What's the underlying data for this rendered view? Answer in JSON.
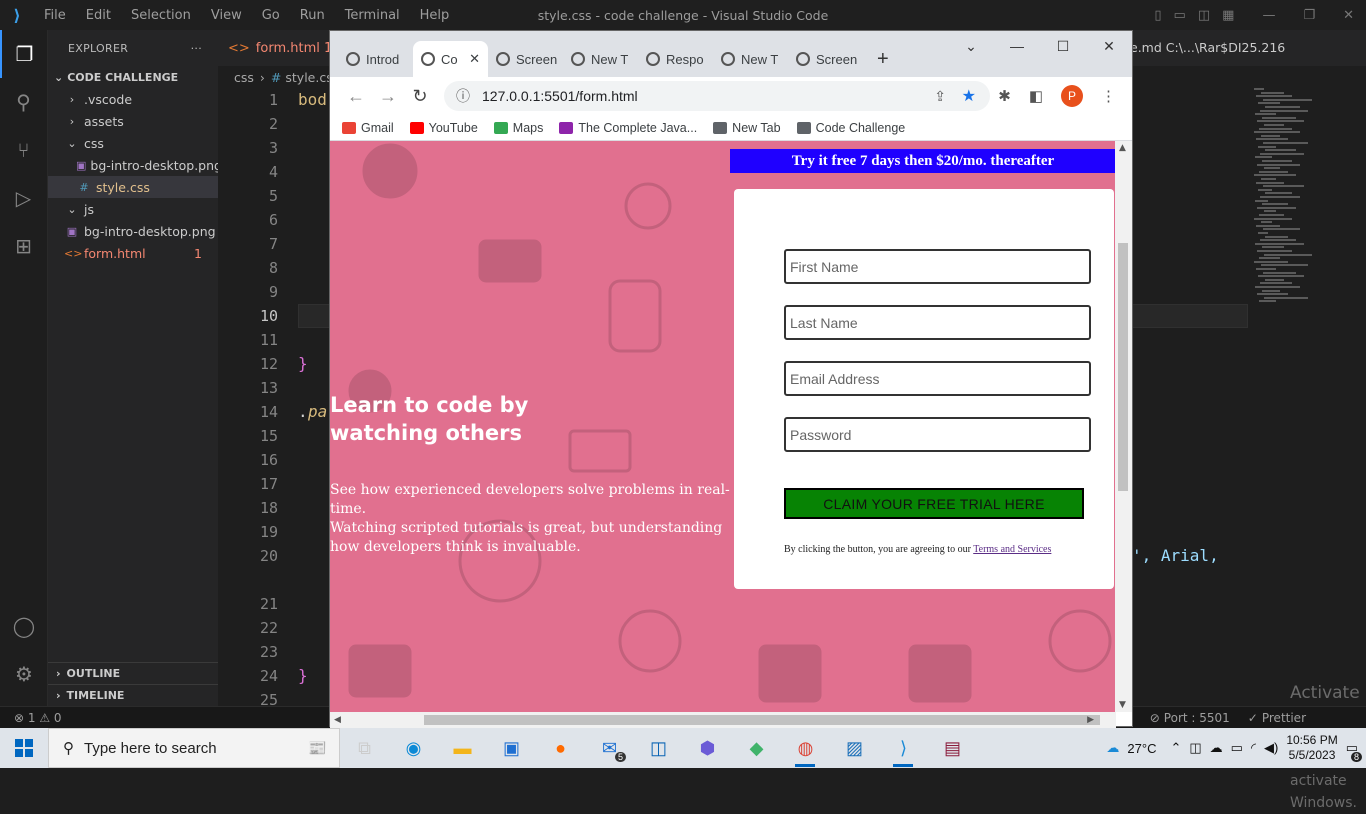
{
  "vscode": {
    "menu": [
      "File",
      "Edit",
      "Selection",
      "View",
      "Go",
      "Run",
      "Terminal",
      "Help"
    ],
    "window_title": "style.css - code challenge - Visual Studio Code",
    "explorer_label": "EXPLORER",
    "project": "CODE CHALLENGE",
    "tree": [
      {
        "label": ".vscode",
        "type": "folder-closed",
        "indent": 1
      },
      {
        "label": "assets",
        "type": "folder-closed",
        "indent": 1
      },
      {
        "label": "css",
        "type": "folder-open",
        "indent": 1
      },
      {
        "label": "bg-intro-desktop.png",
        "type": "image",
        "indent": 2
      },
      {
        "label": "style.css",
        "type": "css",
        "indent": 2,
        "selected": true
      },
      {
        "label": "js",
        "type": "folder-open",
        "indent": 1
      },
      {
        "label": "bg-intro-desktop.png",
        "type": "image",
        "indent": 1
      },
      {
        "label": "form.html",
        "type": "html",
        "indent": 1,
        "badge": "1",
        "error": true
      }
    ],
    "outline_label": "OUTLINE",
    "timeline_label": "TIMELINE",
    "editor_tab": "form.html 1",
    "breadcrumb": [
      "css",
      "style.cs"
    ],
    "line_numbers": [
      "1",
      "2",
      "3",
      "4",
      "5",
      "6",
      "7",
      "8",
      "9",
      "10",
      "11",
      "12",
      "13",
      "14",
      "15",
      "16",
      "17",
      "18",
      "19",
      "20",
      "",
      "21",
      "22",
      "23",
      "24",
      "25"
    ],
    "current_line": "10",
    "code_fragments": {
      "l1": "bod",
      "l12": "}",
      "l14a": ".",
      "l14b": "pa",
      "l20": "', Arial,",
      "l24": "}"
    },
    "right_path": "e.md  C:\\...\\Rar$DI25.216",
    "activate_title": "Activate Windows",
    "activate_sub": "Go to Settings to activate Windows.",
    "status": {
      "errors": "⊗ 1 ⚠ 0",
      "port": "Port : 5501",
      "prettier": "Prettier"
    }
  },
  "browser": {
    "tabs": [
      {
        "label": "Introd",
        "active": false
      },
      {
        "label": "Co",
        "active": true
      },
      {
        "label": "Screen",
        "active": false
      },
      {
        "label": "New T",
        "active": false
      },
      {
        "label": "Respo",
        "active": false
      },
      {
        "label": "New T",
        "active": false
      },
      {
        "label": "Screen",
        "active": false
      }
    ],
    "url": "127.0.0.1:5501/form.html",
    "profile_initial": "P",
    "bookmarks": [
      {
        "label": "Gmail",
        "color": "#ea4335"
      },
      {
        "label": "YouTube",
        "color": "#ff0000"
      },
      {
        "label": "Maps",
        "color": "#34a853"
      },
      {
        "label": "The Complete Java...",
        "color": "#8e24aa"
      },
      {
        "label": "New Tab",
        "color": "#5f6368"
      },
      {
        "label": "Code Challenge",
        "color": "#5f6368"
      }
    ]
  },
  "page": {
    "promo": "Try it free 7 days then $20/mo. thereafter",
    "headline": "Learn to code by watching others",
    "paragraph1": "See how experienced developers solve problems in real-time.",
    "paragraph2": "Watching scripted tutorials is great, but understanding how developers think is invaluable.",
    "placeholders": {
      "first": "First Name",
      "last": "Last Name",
      "email": "Email Address",
      "password": "Password"
    },
    "claim_button": "CLAIM YOUR FREE TRIAL HERE",
    "terms_prefix": "By clicking the button, you are agreeing to our ",
    "terms_link": "Terms and Services",
    "colors": {
      "background": "#e1708f",
      "promo": "#1f00ff",
      "button": "#078304"
    }
  },
  "taskbar": {
    "search_placeholder": "Type here to search",
    "mail_badge": "5",
    "temperature": "27°C",
    "time": "10:56 PM",
    "date": "5/5/2023",
    "notifications": "8"
  }
}
